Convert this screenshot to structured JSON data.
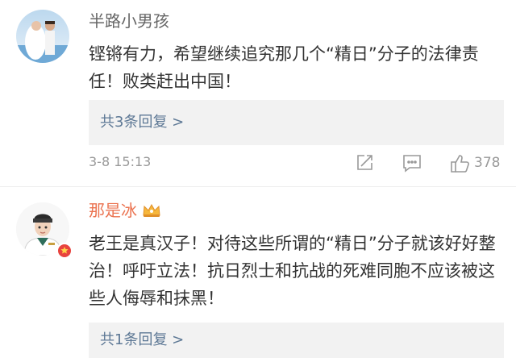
{
  "comments": [
    {
      "username": "半路小男孩",
      "text": "铿锵有力，希望继续追究那几个“精日”分子的法律责任！败类赶出中国！",
      "replies_label": "共3条回复 >",
      "time": "3-8 15:13",
      "like_count": "378",
      "icons": [
        "share-icon",
        "comment-icon",
        "thumbs-up-icon"
      ]
    },
    {
      "username": "那是冰",
      "badge_icon": "crown-icon",
      "text": "老王是真汉子！对待这些所谓的“精日”分子就该好好整治！呼吁立法！抗日烈士和抗战的死难同胞不应该被这些人侮辱和抹黑！",
      "replies_label": "共1条回复 >"
    }
  ],
  "colors": {
    "reply_link": "#5d7895",
    "username_vip": "#eb7350",
    "meta_gray": "#999999",
    "reply_bg": "#f2f2f2"
  }
}
